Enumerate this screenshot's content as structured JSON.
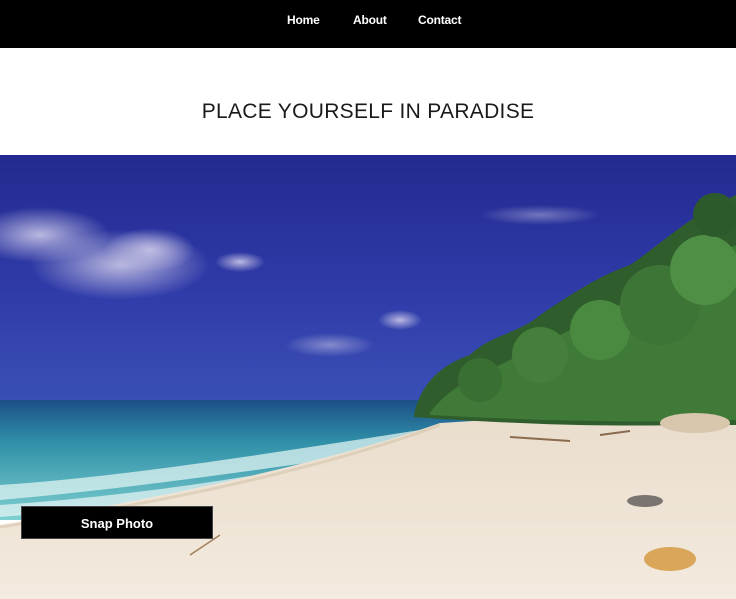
{
  "nav": {
    "home": "Home",
    "about": "About",
    "contact": "Contact"
  },
  "hero": {
    "title": "PLACE YOURSELF IN PARADISE"
  },
  "photo": {
    "subject": "beach-scene"
  },
  "actions": {
    "snap_label": "Snap Photo"
  },
  "colors": {
    "topbar": "#000000",
    "background": "#ffffff",
    "sky": "#2f3aa8",
    "sea": "#3fa8b6",
    "sand": "#efe6d6",
    "foliage": "#3b6f34"
  }
}
